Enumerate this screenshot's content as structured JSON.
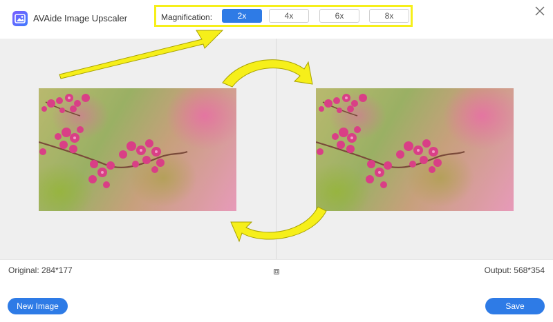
{
  "window": {
    "title": "AVAide Image Upscaler",
    "logo_icon": "avaide-logo-icon",
    "close_icon": "close-icon"
  },
  "magnification": {
    "label": "Magnification:",
    "options": [
      "2x",
      "4x",
      "6x",
      "8x"
    ],
    "selected": "2x"
  },
  "preview": {
    "original_label": "Original: 284*177",
    "output_label": "Output: 568*354",
    "compare_icon": "compare-toggle-icon"
  },
  "footer": {
    "new_image_label": "New Image",
    "save_label": "Save"
  },
  "colors": {
    "accent": "#2e7be6",
    "annotation": "#f6ef1a",
    "preview_bg": "#efefef"
  }
}
